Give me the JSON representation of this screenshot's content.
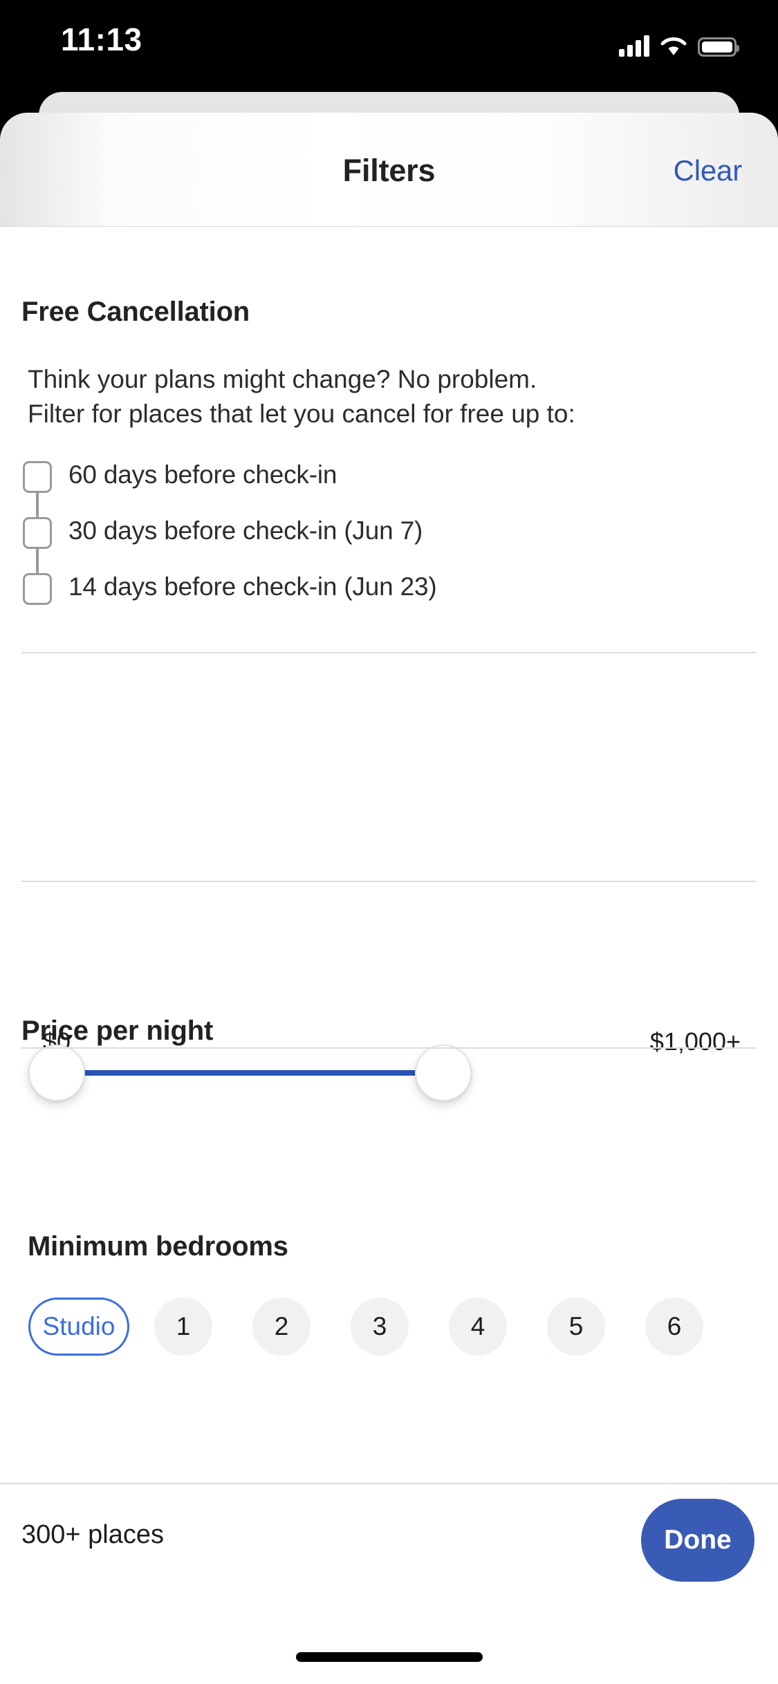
{
  "status_bar": {
    "time": "11:13",
    "cellular_icon": "signal-bars-icon",
    "wifi_icon": "wifi-icon",
    "battery_icon": "battery-icon"
  },
  "header": {
    "title": "Filters",
    "clear_label": "Clear"
  },
  "free_cancellation": {
    "title": "Free Cancellation",
    "description_line_1": "Think your plans might change? No problem.",
    "description_line_2": "Filter for places that let you cancel for free up to:",
    "options": [
      {
        "label": "60 days before check-in",
        "checked": false
      },
      {
        "label": "30 days before check-in (Jun 7)",
        "checked": false
      },
      {
        "label": "14 days before check-in (Jun 23)",
        "checked": false
      }
    ]
  },
  "price_per_night": {
    "title": "Price per night",
    "min_label": "$0",
    "max_label": "$1,000+"
  },
  "minimum_bedrooms": {
    "title": "Minimum bedrooms",
    "options": [
      {
        "label": "Studio",
        "selected": true
      },
      {
        "label": "1",
        "selected": false
      },
      {
        "label": "2",
        "selected": false
      },
      {
        "label": "3",
        "selected": false
      },
      {
        "label": "4",
        "selected": false
      },
      {
        "label": "5",
        "selected": false
      },
      {
        "label": "6",
        "selected": false
      }
    ]
  },
  "footer": {
    "results_count": "300+ places",
    "done_label": "Done"
  },
  "colors": {
    "accent_blue": "#3a5bb5",
    "link_blue": "#3258b8",
    "track_blue": "#2a53b4",
    "pill_selected_border": "#3b6de0",
    "pill_bg": "#f2f1ef"
  }
}
